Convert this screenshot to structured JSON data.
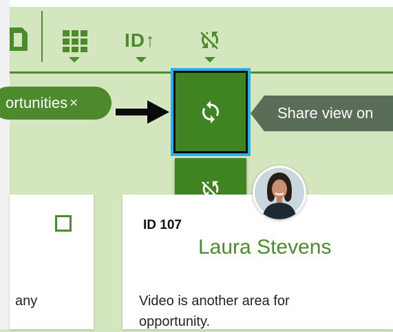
{
  "toolbar": {
    "grid_view_icon": "grid-icon",
    "sort_label": "ID↑",
    "sync_toggle_icon": "sync-disabled-icon"
  },
  "filter_chip": {
    "label": "ortunities",
    "remove": "×"
  },
  "share_button": {
    "icon": "sync-icon"
  },
  "unsync_button": {
    "icon": "sync-disabled-icon"
  },
  "tooltip": {
    "text": "Share view on"
  },
  "cards": [
    {
      "description": "any"
    },
    {
      "id": "ID 107",
      "name": "Laura Stevens",
      "description": "Video is another area for opportunity."
    }
  ],
  "colors": {
    "accent": "#4d8a2e",
    "button": "#3f8420",
    "background": "#d4e6bd",
    "highlight": "#29b0ea",
    "tooltip": "#5a6d58"
  }
}
